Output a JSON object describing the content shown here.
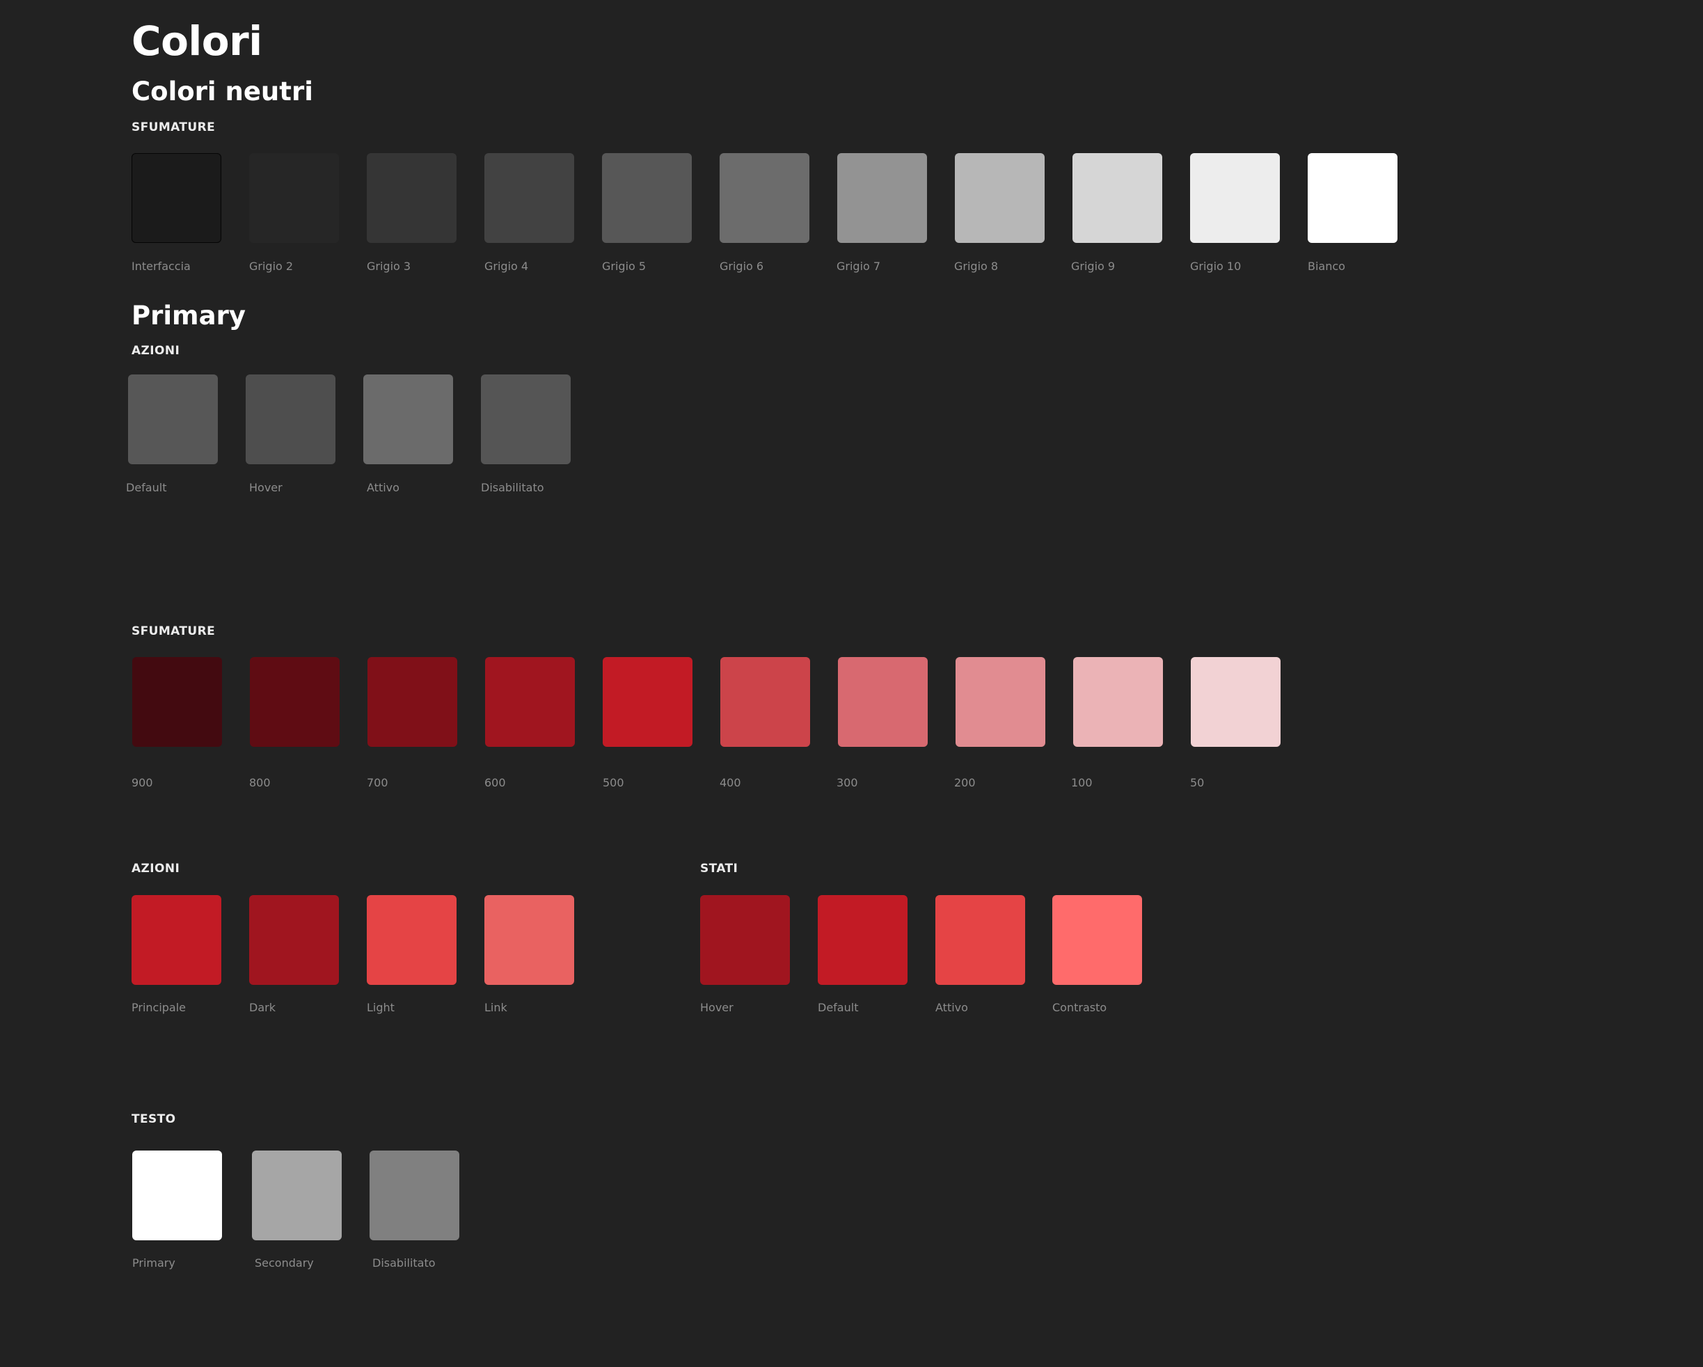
{
  "title": "Colori",
  "neutral": {
    "heading": "Colori neutri",
    "label": "SFUMATURE",
    "swatches": [
      {
        "name": "Interfaccia",
        "color": "#1b1b1b",
        "border": "#050505"
      },
      {
        "name": "Grigio 2",
        "color": "#262626"
      },
      {
        "name": "Grigio 3",
        "color": "#353535"
      },
      {
        "name": "Grigio 4",
        "color": "#424242"
      },
      {
        "name": "Grigio 5",
        "color": "#575757"
      },
      {
        "name": "Grigio 6",
        "color": "#6c6c6c"
      },
      {
        "name": "Grigio 7",
        "color": "#939393"
      },
      {
        "name": "Grigio 8",
        "color": "#b7b7b7"
      },
      {
        "name": "Grigio 9",
        "color": "#d6d6d6"
      },
      {
        "name": "Grigio 10",
        "color": "#ededed"
      },
      {
        "name": "Bianco",
        "color": "#ffffff"
      }
    ]
  },
  "primary": {
    "heading": "Primary",
    "actions_label": "AZIONI",
    "actions": [
      {
        "name": "Default",
        "color": "#575757"
      },
      {
        "name": "Hover",
        "color": "#4e4e4e"
      },
      {
        "name": "Attivo",
        "color": "#6b6b6b"
      },
      {
        "name": "Disabilitato",
        "color": "#555555"
      }
    ]
  },
  "red": {
    "shades_label": "SFUMATURE",
    "shades": [
      {
        "name": "900",
        "color": "#430a10"
      },
      {
        "name": "800",
        "color": "#5f0c13"
      },
      {
        "name": "700",
        "color": "#801018"
      },
      {
        "name": "600",
        "color": "#a0151f"
      },
      {
        "name": "500",
        "color": "#c21b25"
      },
      {
        "name": "400",
        "color": "#cc444a"
      },
      {
        "name": "300",
        "color": "#d86970"
      },
      {
        "name": "200",
        "color": "#e18c91"
      },
      {
        "name": "100",
        "color": "#ebb3b6"
      },
      {
        "name": "50",
        "color": "#f2d2d4"
      }
    ],
    "actions_label": "AZIONI",
    "actions": [
      {
        "name": "Principale",
        "color": "#c21b25"
      },
      {
        "name": "Dark",
        "color": "#a0151f"
      },
      {
        "name": "Light",
        "color": "#e54445"
      },
      {
        "name": "Link",
        "color": "#e96261"
      }
    ],
    "states_label": "STATI",
    "states": [
      {
        "name": "Hover",
        "color": "#a0151f"
      },
      {
        "name": "Default",
        "color": "#c21b25"
      },
      {
        "name": "Attivo",
        "color": "#e54445"
      },
      {
        "name": "Contrasto",
        "color": "#ff6b6b"
      }
    ]
  },
  "text": {
    "label": "TESTO",
    "swatches": [
      {
        "name": "Primary",
        "color": "#ffffff"
      },
      {
        "name": "Secondary",
        "color": "#a6a6a6"
      },
      {
        "name": "Disabilitato",
        "color": "#808080"
      }
    ]
  }
}
